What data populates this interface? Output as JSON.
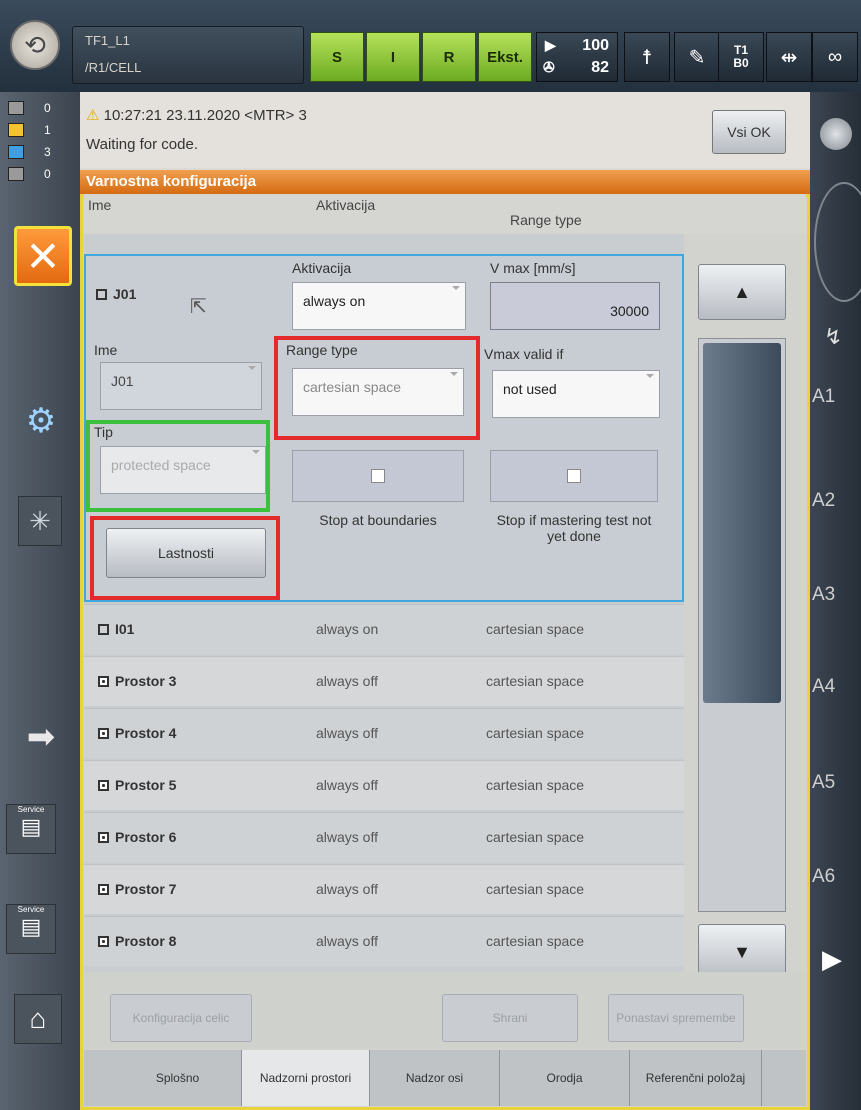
{
  "header": {
    "robot_line1": "TF1_L1",
    "robot_line2": "/R1/CELL",
    "modes": [
      "S",
      "I",
      "R",
      "Ekst."
    ],
    "speed_override": "100",
    "speed_program": "82",
    "mode_t1": "T1",
    "mode_b0": "B0",
    "infinity": "∞"
  },
  "left": {
    "msg_counts": [
      "0",
      "1",
      "3",
      "0"
    ],
    "service_label": "Service"
  },
  "alarm": {
    "title": "10:27:21 23.11.2020 <MTR> 3",
    "subtitle": "Waiting for code.",
    "ack_button": "Vsi OK"
  },
  "window_title": "Varnostna konfiguracija",
  "columns": [
    "Ime",
    "Aktivacija",
    "Range type"
  ],
  "detail": {
    "name": "J01",
    "activation_label": "Aktivacija",
    "activation_value": "always on",
    "vmax_label": "V max [mm/s]",
    "vmax_value": "30000",
    "name_label": "Ime",
    "name_value": "J01",
    "range_type_label": "Range type",
    "range_type_value": "cartesian space",
    "vmax_valid_label": "Vmax valid if",
    "vmax_valid_value": "not used",
    "tip_label": "Tip",
    "tip_value": "protected space",
    "stop_boundaries": "Stop at boundaries",
    "stop_mastering": "Stop if mastering test not yet done",
    "properties_button": "Lastnosti"
  },
  "rows": [
    {
      "name": "I01",
      "activation": "always on",
      "range": "cartesian space"
    },
    {
      "name": "Prostor 3",
      "activation": "always off",
      "range": "cartesian space"
    },
    {
      "name": "Prostor 4",
      "activation": "always off",
      "range": "cartesian space"
    },
    {
      "name": "Prostor 5",
      "activation": "always off",
      "range": "cartesian space"
    },
    {
      "name": "Prostor 6",
      "activation": "always off",
      "range": "cartesian space"
    },
    {
      "name": "Prostor 7",
      "activation": "always off",
      "range": "cartesian space"
    },
    {
      "name": "Prostor 8",
      "activation": "always off",
      "range": "cartesian space"
    }
  ],
  "axes": [
    "A1",
    "A2",
    "A3",
    "A4",
    "A5",
    "A6"
  ],
  "bottom_buttons": {
    "cell_config": "Konfiguracija celic",
    "save": "Shrani",
    "reset": "Ponastavi spremembe"
  },
  "tabs": [
    "Splošno",
    "Nadzorni prostori",
    "Nadzor osi",
    "Orodja",
    "Referenčni položaj"
  ],
  "colors": {
    "accent_orange": "#e36a10",
    "highlight_red": "#e22a2a",
    "highlight_green": "#3fbf3f",
    "selection_blue": "#3fa7de",
    "mode_green": "#8bc53a"
  }
}
